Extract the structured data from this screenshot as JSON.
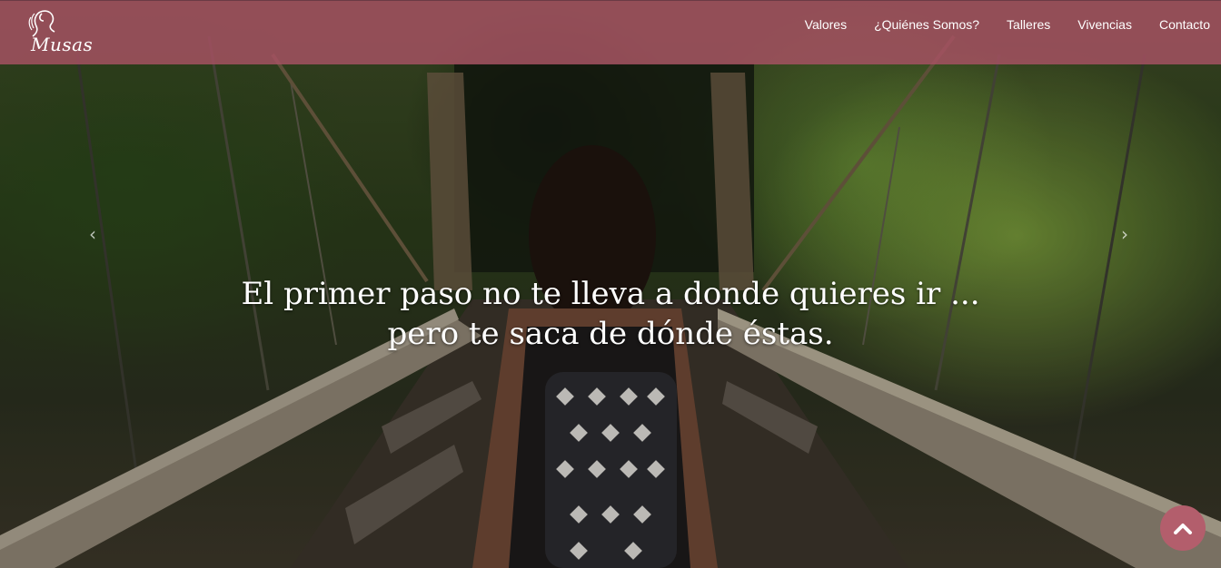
{
  "brand": {
    "logo_text": "Musas"
  },
  "nav": {
    "items": [
      {
        "label": "Valores"
      },
      {
        "label": "¿Quiénes Somos?"
      },
      {
        "label": "Talleres"
      },
      {
        "label": "Vivencias"
      },
      {
        "label": "Contacto"
      }
    ]
  },
  "hero": {
    "headline_line1": "El primer paso no te lleva a donde quieres ir ...",
    "headline_line2": "pero te saca de dónde éstas.",
    "prev_arrow": "‹",
    "next_arrow": "›"
  },
  "colors": {
    "header_bg": "#a85264",
    "scroll_button_bg": "#b35e6c"
  },
  "icons": {
    "scroll_top": "chevron-up-icon",
    "logo": "woman-profile-icon"
  }
}
